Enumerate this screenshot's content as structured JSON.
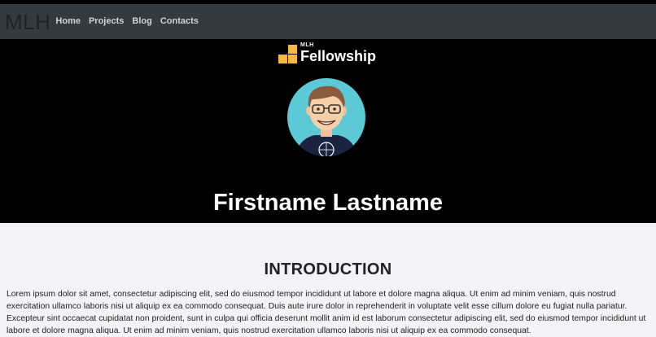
{
  "nav": {
    "brand": "MLH",
    "links": [
      "Home",
      "Projects",
      "Blog",
      "Contacts"
    ]
  },
  "hero": {
    "logo_small": "MLH",
    "logo_word": "Fellowship",
    "name": "Firstname Lastname"
  },
  "intro": {
    "title": "INTRODUCTION",
    "body": "Lorem ipsum dolor sit amet, consectetur adipiscing elit, sed do eiusmod tempor incididunt ut labore et dolore magna aliqua. Ut enim ad minim veniam, quis nostrud exercitation ullamco laboris nisi ut aliquip ex ea commodo consequat. Duis aute irure dolor in reprehenderit in voluptate velit esse cillum dolore eu fugiat nulla pariatur. Excepteur sint occaecat cupidatat non proident, sunt in culpa qui officia deserunt mollit anim id est laborum consectetur adipiscing elit, sed do eiusmod tempor incididunt ut labore et dolore magna aliqua. Ut enim ad minim veniam, quis nostrud exercitation ullamco laboris nisi ut aliquip ex ea commodo consequat."
  },
  "colors": {
    "navbar_bg": "#343a40",
    "hero_bg": "#000000",
    "page_bg": "#f3f3f5",
    "logo_orange": "#f4b942",
    "avatar_bg": "#5bc9d6"
  },
  "icons": {
    "logo_mark": "fellowship-blocks-icon",
    "avatar": "cartoon-avatar-image"
  }
}
